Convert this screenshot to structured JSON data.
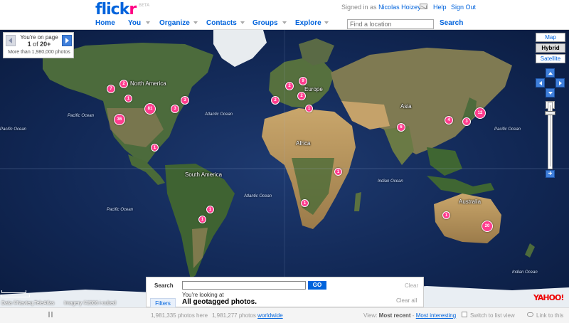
{
  "header": {
    "logo_main": "flick",
    "logo_accent": "r",
    "logo_beta": "BETA",
    "signed_in_prefix": "Signed in as",
    "user_name": "Nicolas Hoizey",
    "help": "Help",
    "sign_out": "Sign Out",
    "nav": [
      {
        "label": "Home",
        "dropdown": false
      },
      {
        "label": "You",
        "dropdown": true
      },
      {
        "label": "Organize",
        "dropdown": true
      },
      {
        "label": "Contacts",
        "dropdown": true
      },
      {
        "label": "Groups",
        "dropdown": true
      },
      {
        "label": "Explore",
        "dropdown": true
      }
    ],
    "location_placeholder": "Find a location",
    "search_label": "Search"
  },
  "pager": {
    "line1": "You're on page",
    "current_page": "1",
    "of": "of",
    "total_pages": "20+",
    "line3": "More than 1,980,000 photos"
  },
  "map_types": [
    "Map",
    "Hybrid",
    "Satellite"
  ],
  "map_type_selected": "Hybrid",
  "zoom_level_fraction": 0.12,
  "map_labels": {
    "oceans": [
      "Pacific Ocean",
      "Atlantic Ocean",
      "Pacific Ocean",
      "Indian Ocean",
      "Pacific Ocean",
      "Atlantic Ocean",
      "Pacific Ocean",
      "Indian Ocean"
    ],
    "land": [
      "North America",
      "Europe",
      "Asia",
      "Africa",
      "South America",
      "Australia"
    ]
  },
  "clusters": [
    "7",
    "2",
    "1",
    "3",
    "81",
    "3",
    "36",
    "1",
    "2",
    "9",
    "2",
    "2",
    "1",
    "6",
    "4",
    "3",
    "12",
    "1",
    "1",
    "1",
    "1",
    "20",
    "1"
  ],
  "credits": {
    "data": "Data ©Navteq,TeleAtlas",
    "imagery": "Imagery ©2006 i-cubed",
    "yahoo": "YAHOO!"
  },
  "search_panel": {
    "label": "Search",
    "input_value": "",
    "go": "GO",
    "clear": "Clear",
    "filters_tab": "Filters",
    "looking_at": "You're looking at",
    "scope": "All geotagged photos.",
    "clear_all": "Clear all"
  },
  "footer": {
    "photos_here": "1,981,335 photos here",
    "photos_world_count": "1,981,277 photos",
    "worldwide": "worldwide",
    "view_prefix": "View:",
    "most_recent": "Most recent",
    "separator": "-",
    "most_interesting": "Most interesting",
    "list_view": "Switch to list view",
    "link_to_this": "Link to this"
  },
  "colors": {
    "flickr_blue": "#0063dc",
    "flickr_pink": "#ff0084",
    "cluster_pink": "#ff3d8e",
    "ocean": "#112754",
    "land": "#4b6b3a"
  }
}
